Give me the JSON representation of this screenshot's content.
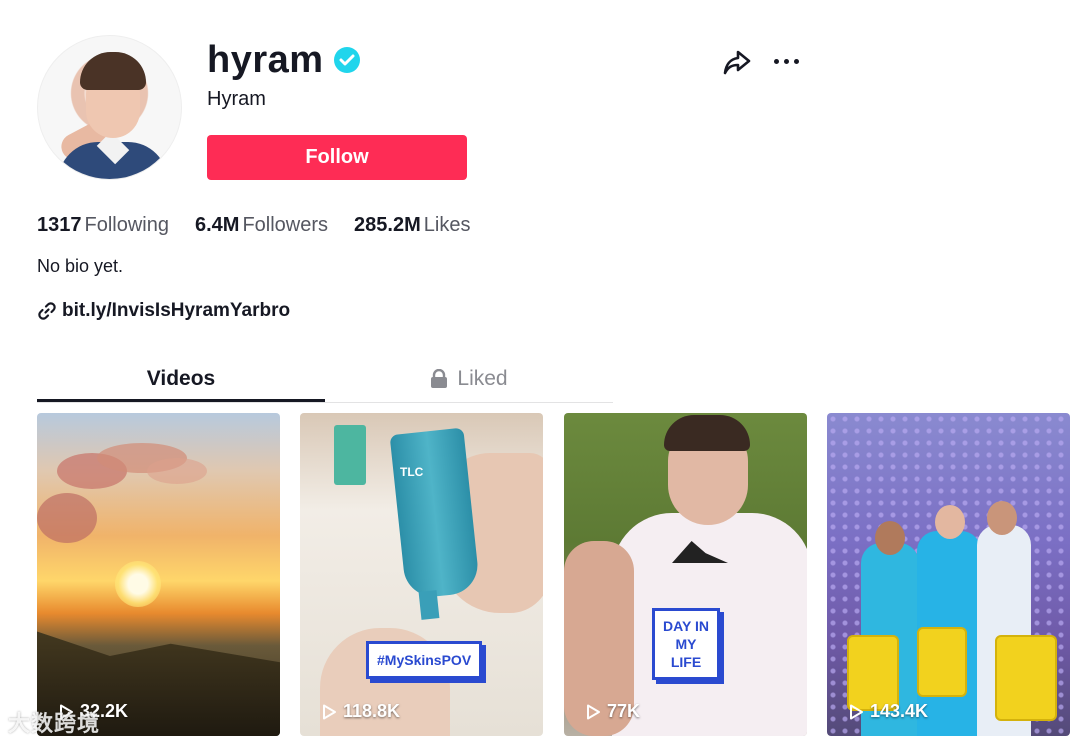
{
  "profile": {
    "username": "hyram",
    "nickname": "Hyram",
    "follow_label": "Follow",
    "bio": "No bio yet.",
    "link": "bit.ly/InvisIsHyramYarbro"
  },
  "stats": {
    "following_count": "1317",
    "following_label": "Following",
    "followers_count": "6.4M",
    "followers_label": "Followers",
    "likes_count": "285.2M",
    "likes_label": "Likes"
  },
  "tabs": {
    "videos": "Videos",
    "liked": "Liked"
  },
  "videos": [
    {
      "views": "32.2K"
    },
    {
      "views": "118.8K",
      "sticker": "#MySkinsPOV",
      "overlay": "TLC"
    },
    {
      "views": "77K",
      "sticker_line1": "DAY IN",
      "sticker_line2": "MY LIFE"
    },
    {
      "views": "143.4K"
    }
  ],
  "watermark": "大数跨境",
  "colors": {
    "accent": "#fe2c55",
    "verified": "#20d5ec",
    "text": "#161823",
    "muted": "#8a8b91"
  },
  "icons": [
    "verified-badge-icon",
    "share-icon",
    "more-icon",
    "link-icon",
    "lock-icon",
    "play-icon"
  ]
}
